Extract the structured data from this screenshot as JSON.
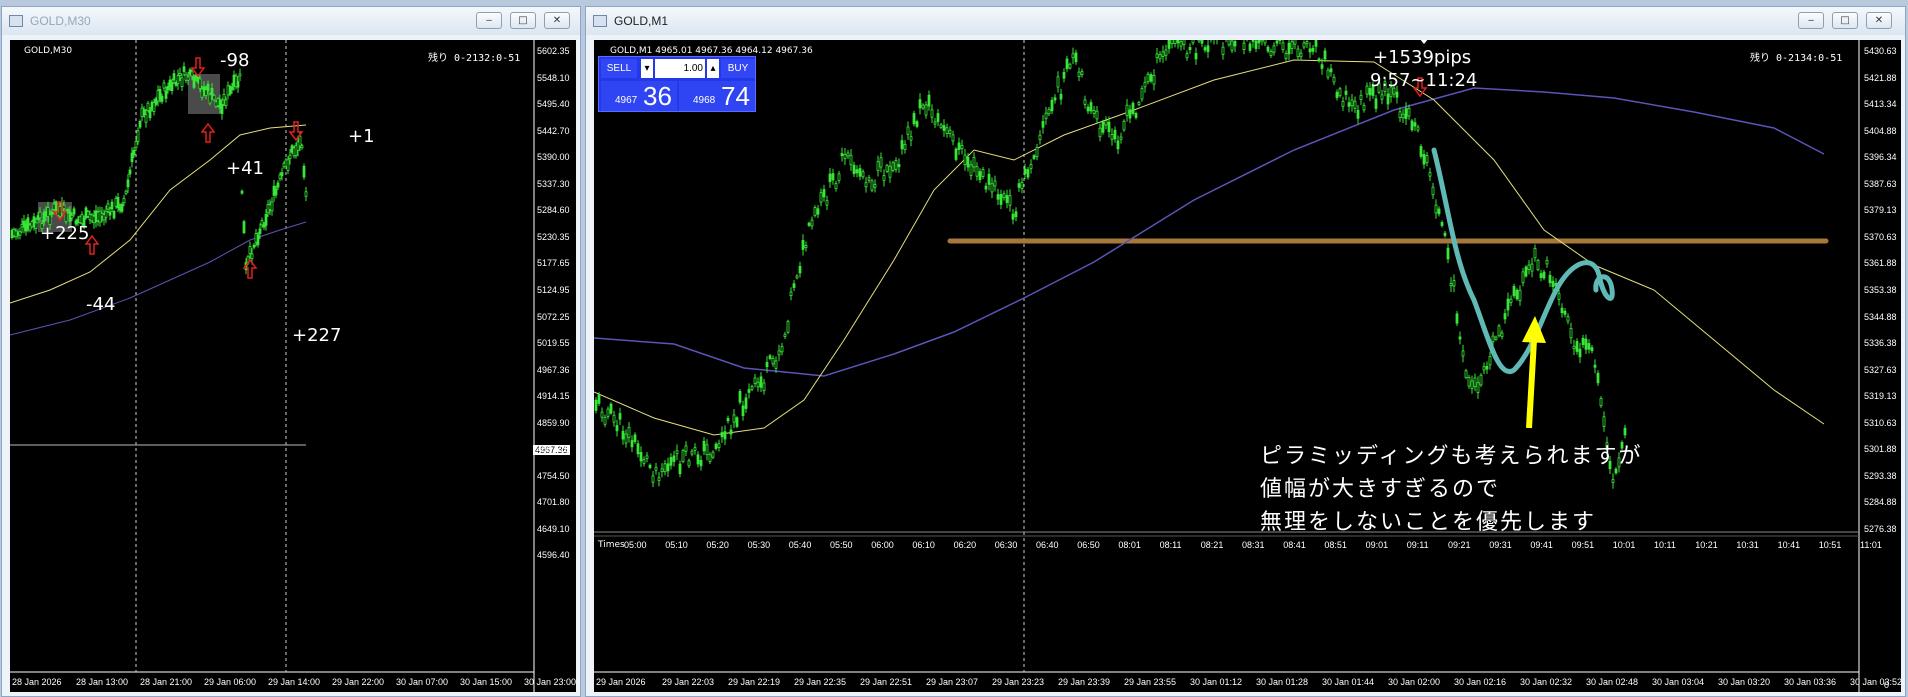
{
  "left_window": {
    "title": "GOLD,M30",
    "symbol_label": "GOLD,M30",
    "remaining": "残り 0-2132:0-51",
    "annotations": [
      "-98",
      "+41",
      "+225",
      "-44",
      "+227",
      "+1"
    ],
    "price_ticks": [
      "5602.35",
      "5548.10",
      "5495.40",
      "5442.70",
      "5390.00",
      "5337.30",
      "5284.60",
      "5230.35",
      "5177.65",
      "5124.95",
      "5072.25",
      "5019.55",
      "4967.36",
      "4914.15",
      "4859.90",
      "4807.20",
      "4754.50",
      "4701.80",
      "4649.10",
      "4596.40"
    ],
    "current_price": "4967.36",
    "time_ticks": [
      "28 Jan 2026",
      "28 Jan 13:00",
      "28 Jan 21:00",
      "29 Jan 06:00",
      "29 Jan 14:00",
      "29 Jan 22:00",
      "30 Jan 07:00",
      "30 Jan 15:00",
      "30 Jan 23:00"
    ]
  },
  "right_window": {
    "title": "GOLD,M1",
    "symbol_label": "GOLD,M1  4965.01 4967.36 4964.12 4967.36",
    "remaining": "残り 0-2134:0-51",
    "trade_panel": {
      "sell_label": "SELL",
      "buy_label": "BUY",
      "lot": "1.00",
      "sell_prefix": "4967",
      "sell_big": "36",
      "buy_prefix": "4968",
      "buy_big": "74"
    },
    "pips_annotation": "+1539pips",
    "time_range_annotation": "9:57~11:24",
    "comment_lines": [
      "ピラミッディングも考えられますが",
      "値幅が大きすぎるので",
      "無理をしないことを優先します"
    ],
    "indicator_label": "Times",
    "price_ticks": [
      "5430.63",
      "5421.88",
      "5413.34",
      "5404.88",
      "5396.34",
      "5387.63",
      "5379.13",
      "5370.63",
      "5361.88",
      "5353.38",
      "5344.88",
      "5336.38",
      "5327.63",
      "5319.13",
      "5310.63",
      "5301.88",
      "5293.38",
      "5284.88",
      "5276.38"
    ],
    "subpanel_ticks": [
      "0"
    ],
    "minute_ticks": [
      "05:00",
      "05:10",
      "05:20",
      "05:30",
      "05:40",
      "05:50",
      "06:00",
      "06:10",
      "06:20",
      "06:30",
      "06:40",
      "06:50",
      "08:01",
      "08:11",
      "08:21",
      "08:31",
      "08:41",
      "08:51",
      "09:01",
      "09:11",
      "09:21",
      "09:31",
      "09:41",
      "09:51",
      "10:01",
      "10:11",
      "10:21",
      "10:31",
      "10:41",
      "10:51",
      "11:01"
    ],
    "date_ticks": [
      "29 Jan 2026",
      "29 Jan 22:03",
      "29 Jan 22:19",
      "29 Jan 22:35",
      "29 Jan 22:51",
      "29 Jan 23:07",
      "29 Jan 23:23",
      "29 Jan 23:39",
      "29 Jan 23:55",
      "30 Jan 01:12",
      "30 Jan 01:28",
      "30 Jan 01:44",
      "30 Jan 02:00",
      "30 Jan 02:16",
      "30 Jan 02:32",
      "30 Jan 02:48",
      "30 Jan 03:04",
      "30 Jan 03:20",
      "30 Jan 03:36",
      "30 Jan 03:52"
    ]
  },
  "colors": {
    "candle": "#39e639",
    "ma_fast": "#e6e07a",
    "ma_slow": "#5a55b8",
    "support_line": "#a8773a",
    "freehand": "#5fbab6",
    "arrow": "#ffff00",
    "entry_arrow": "#e02020"
  }
}
